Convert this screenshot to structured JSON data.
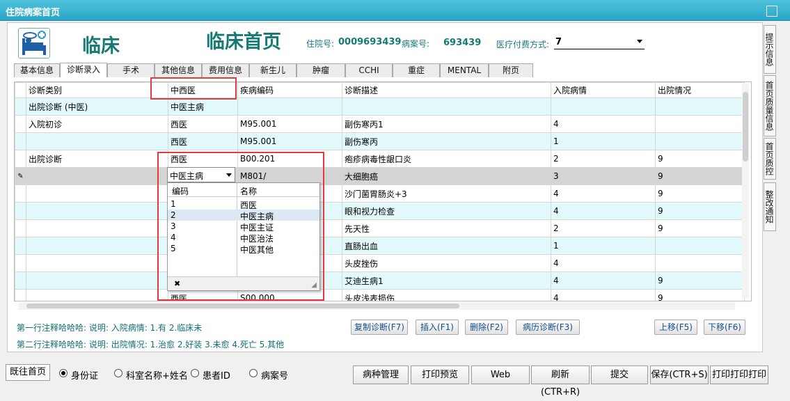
{
  "window": {
    "title": "住院病案首页"
  },
  "header": {
    "clinic_label": "临床",
    "page_title": "临床首页",
    "admission_no_label": "住院号:",
    "admission_no": "0009693439",
    "record_no_label": "病案号:",
    "record_no": "693439",
    "payment_label": "医疗付费方式:",
    "payment_value": "7"
  },
  "tabs": [
    "基本信息",
    "诊断录入",
    "手术",
    "其他信息",
    "费用信息",
    "新生儿",
    "肿瘤",
    "CCHI",
    "重症",
    "MENTAL",
    "附页"
  ],
  "grid": {
    "columns": [
      "诊断类别",
      "中西医",
      "疾病编码",
      "诊断描述",
      "入院病情",
      "出院情况"
    ],
    "rows": [
      [
        "出院诊断 (中医)",
        "中医主病",
        "",
        "",
        "",
        ""
      ],
      [
        "入院初诊",
        "西医",
        "M95.001",
        "副伤寒丙1",
        "4",
        ""
      ],
      [
        "",
        "西医",
        "M95.001",
        "副伤寒丙",
        "1",
        ""
      ],
      [
        "出院诊断",
        "西医",
        "B00.201",
        "疱疹病毒性龈口炎",
        "2",
        "9"
      ],
      [
        "",
        "中医主病",
        "M801/",
        "大细胞癌",
        "3",
        "9"
      ],
      [
        "",
        "",
        "",
        "沙门菌胃肠炎+3",
        "4",
        "9"
      ],
      [
        "",
        "",
        "",
        "眼和视力检查",
        "4",
        "9"
      ],
      [
        "",
        "",
        "",
        "先天性",
        "2",
        "9"
      ],
      [
        "",
        "",
        "",
        "直肠出血",
        "1",
        ""
      ],
      [
        "",
        "",
        "",
        "头皮挫伤",
        "4",
        ""
      ],
      [
        "",
        "",
        "",
        "艾迪生病1",
        "4",
        "9"
      ],
      [
        "",
        "西医",
        "S00.000",
        "头皮浅表损伤",
        "4",
        "9"
      ]
    ]
  },
  "dropdown": {
    "selected": "中医主病",
    "headers": [
      "编码",
      "名称"
    ],
    "options": [
      {
        "code": "1",
        "name": "西医"
      },
      {
        "code": "2",
        "name": "中医主病"
      },
      {
        "code": "3",
        "name": "中医主证"
      },
      {
        "code": "4",
        "name": "中医治法"
      },
      {
        "code": "5",
        "name": "中医其他"
      }
    ],
    "clear_glyph": "✖"
  },
  "notes": {
    "line1": "第一行注释哈哈哈: 说明: 入院病情: 1.有 2.临床未",
    "line2": "第二行注释哈哈哈: 说明: 出院情况: 1.治愈 2.好装 3.未愈 4.死亡 5.其他"
  },
  "actions": {
    "copy": "复制诊断(F7)",
    "insert": "插入(F1)",
    "delete": "删除(F2)",
    "history": "病历诊断(F3)",
    "up": "上移(F5)",
    "down": "下移(F6)"
  },
  "side_tabs": [
    "提示信息",
    "首页质量信息",
    "首页质控",
    "整改通知"
  ],
  "bottom": {
    "prev_home": "既往首页",
    "radios": [
      "身份证",
      "科室名称+姓名",
      "患者ID",
      "病案号"
    ],
    "buttons": [
      "病种管理",
      "打印预览",
      "Web",
      "刷新(CTR+R)",
      "提交",
      "保存(CTR+S)",
      "打印打印打印"
    ]
  }
}
